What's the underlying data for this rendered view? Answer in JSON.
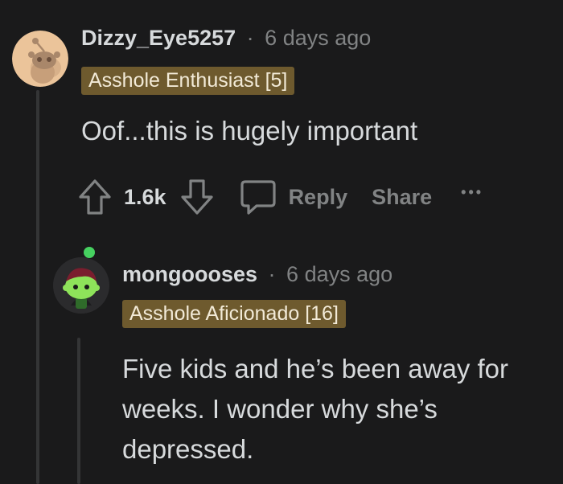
{
  "comments": [
    {
      "username": "Dizzy_Eye5257",
      "separator": "·",
      "time": "6 days ago",
      "flair": "Asshole Enthusiast [5]",
      "body": "Oof...this is hugely important",
      "votes": "1.6k",
      "reply_label": "Reply",
      "share_label": "Share",
      "more_label": "•••",
      "avatar_icon": "snoo-default-avatar-icon"
    },
    {
      "username": "mongoooses",
      "separator": "·",
      "time": "6 days ago",
      "flair": "Asshole Aficionado [16]",
      "body_lines": [
        "Five kids and he’s been away for",
        "weeks. I wonder why she’s",
        "depressed."
      ],
      "avatar_icon": "snoo-green-avatar-icon"
    }
  ],
  "colors": {
    "background": "#1a1a1b",
    "flair_bg": "#6e5a2e",
    "muted": "#818384",
    "text": "#d7dadc",
    "online_dot": "#46d160"
  }
}
